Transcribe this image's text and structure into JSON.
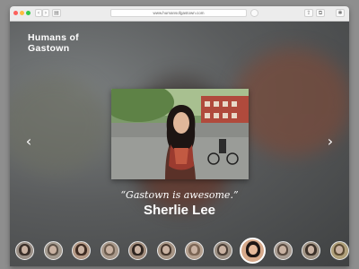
{
  "browser": {
    "url": "www.humansofgastown.com",
    "back_glyph": "‹",
    "forward_glyph": "›",
    "sidebar_glyph": "▤",
    "share_glyph": "⇪",
    "tabs_glyph": "⧉",
    "extension_glyph": "✱"
  },
  "site": {
    "title_line1": "Humans of",
    "title_line2": "Gastown"
  },
  "slider": {
    "prev_glyph": "‹",
    "next_glyph": "›",
    "quote": "“Gastown is awesome.”",
    "name": "Sherlie Lee",
    "active_index": 8,
    "thumbnails": [
      {
        "tone": "#9a8f86",
        "hair": "#3a2f29"
      },
      {
        "tone": "#a39a8f",
        "hair": "#5c5046"
      },
      {
        "tone": "#b39885",
        "hair": "#3e2b22"
      },
      {
        "tone": "#a8988a",
        "hair": "#6a5a4c"
      },
      {
        "tone": "#9f8a7a",
        "hair": "#2f2520"
      },
      {
        "tone": "#a69484",
        "hair": "#45362c"
      },
      {
        "tone": "#b4a08f",
        "hair": "#7b6554"
      },
      {
        "tone": "#9c9084",
        "hair": "#4a3e35"
      },
      {
        "tone": "#d7a98a",
        "hair": "#1e1614"
      },
      {
        "tone": "#a89c92",
        "hair": "#58493f"
      },
      {
        "tone": "#a09384",
        "hair": "#3c3129"
      },
      {
        "tone": "#b0a07a",
        "hair": "#5b4a32"
      }
    ]
  }
}
